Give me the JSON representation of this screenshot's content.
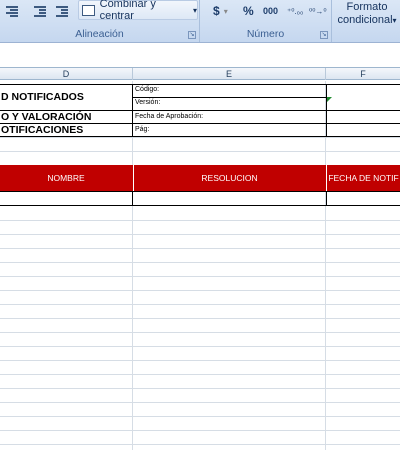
{
  "ribbon": {
    "merge_center_label": "Combinar y centrar",
    "merge_dropdown": "▾",
    "alignment_group_label": "Alineación",
    "currency_symbol": "$",
    "currency_dropdown": "▾",
    "percent_symbol": "%",
    "thousands_symbol": "000",
    "increase_decimal": "⁺⁰.₀₀",
    "decrease_decimal": "⁰⁰→⁰",
    "number_group_label": "Número",
    "conditional_format_line1": "Formato",
    "conditional_format_line2": "condicional",
    "conditional_format_dropdown": "▾",
    "launcher_glyph": "↘"
  },
  "columns": [
    "D",
    "E",
    "F"
  ],
  "sheet": {
    "title_1": "D NOTIFICADOS",
    "title_2": "O Y VALORACIÓN",
    "title_3": "OTIFICACIONES",
    "codigo_label": "Código:",
    "version_label": "Versión:",
    "fecha_aprobacion_label": "Fecha de Aprobación:",
    "pag_label": "Pág:"
  },
  "table_header": {
    "nombre": "NOMBRE",
    "resolucion": "RESOLUCION",
    "fecha_notif": "FECHA DE NOTIF"
  },
  "colors": {
    "header_red": "#c00000",
    "ribbon_bg": "#dbe7f6",
    "ribbon_text": "#3b5f92"
  }
}
